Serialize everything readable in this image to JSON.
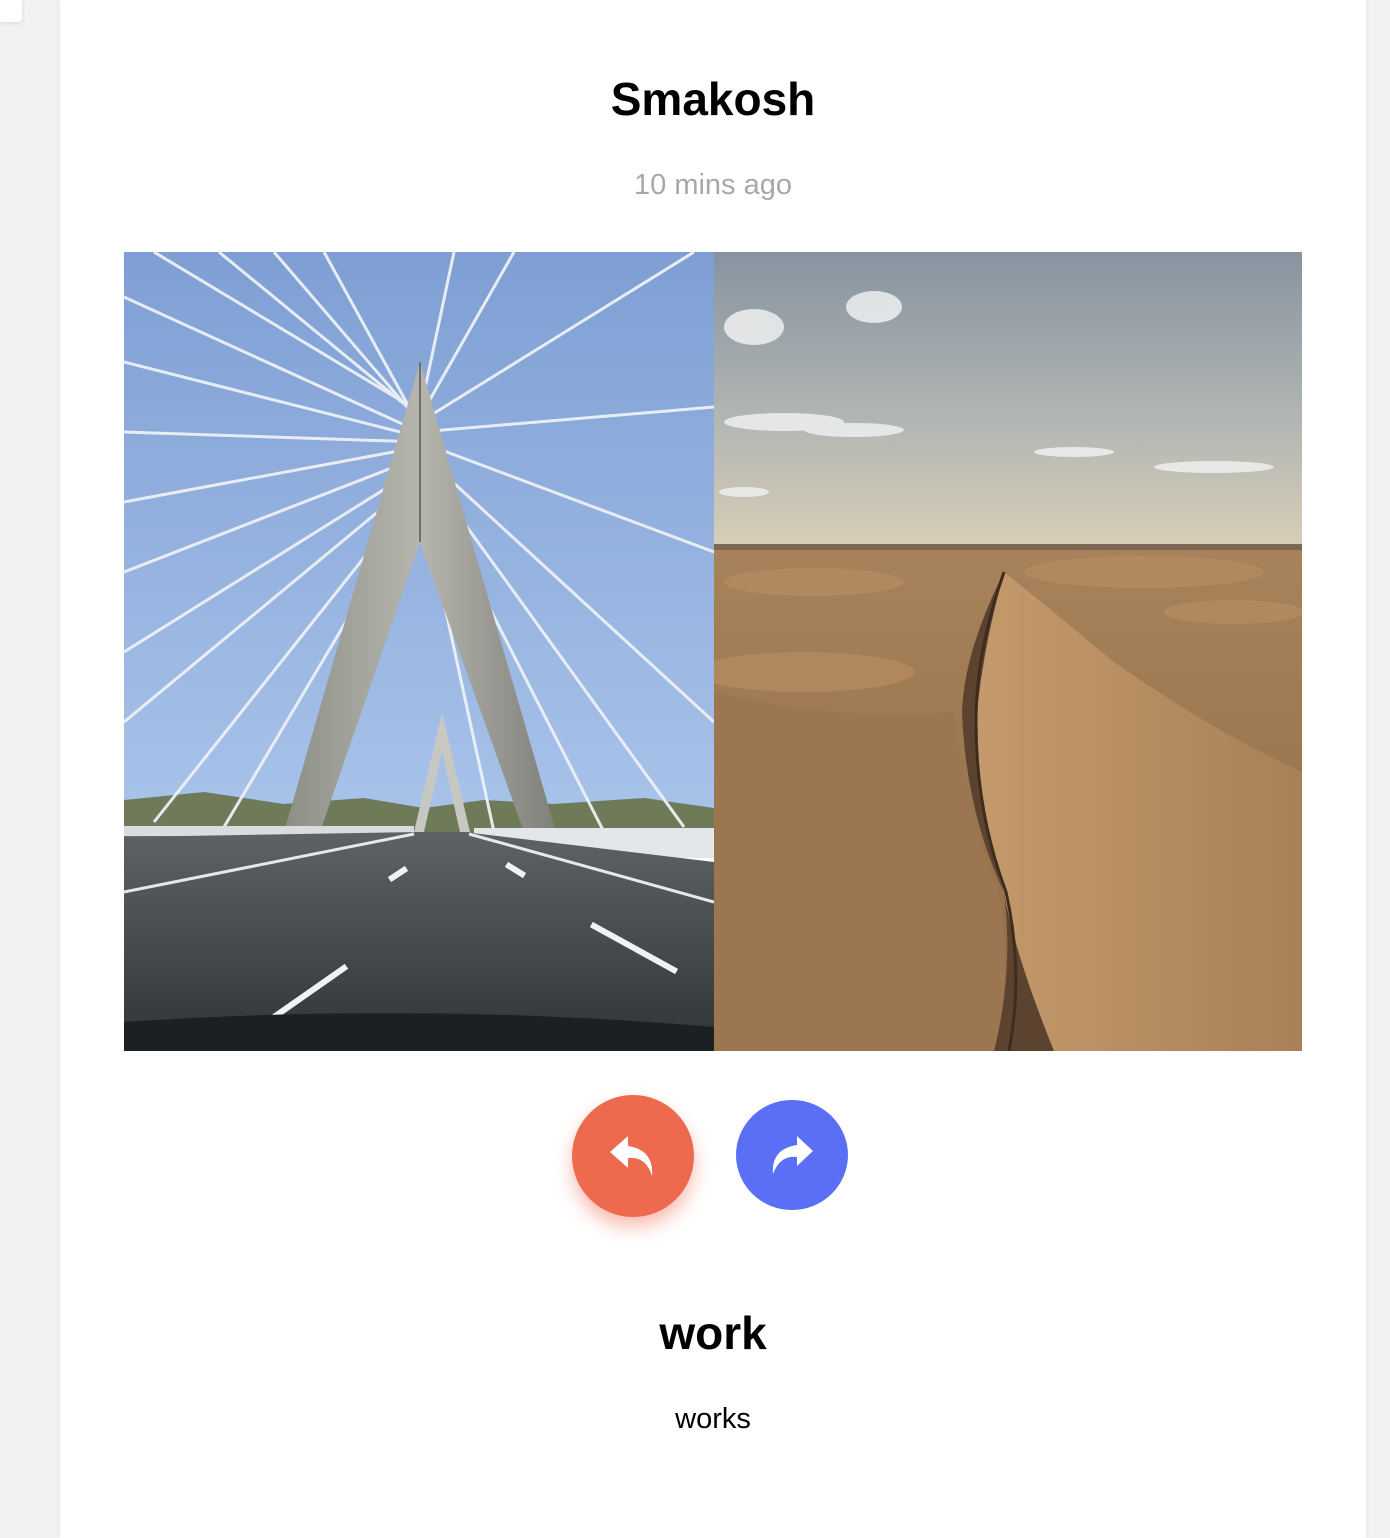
{
  "post": {
    "author": "Smakosh",
    "time_ago": "10 mins ago"
  },
  "gallery": {
    "images": [
      {
        "alt": "Cable-stayed bridge over a highway"
      },
      {
        "alt": "Sand dunes in the desert"
      }
    ]
  },
  "controls": {
    "prev_icon": "reply-arrow-icon",
    "next_icon": "share-arrow-icon",
    "prev_color": "#ee6a4f",
    "next_color": "#5a6ef6"
  },
  "caption": {
    "title": "work",
    "text": "works"
  }
}
